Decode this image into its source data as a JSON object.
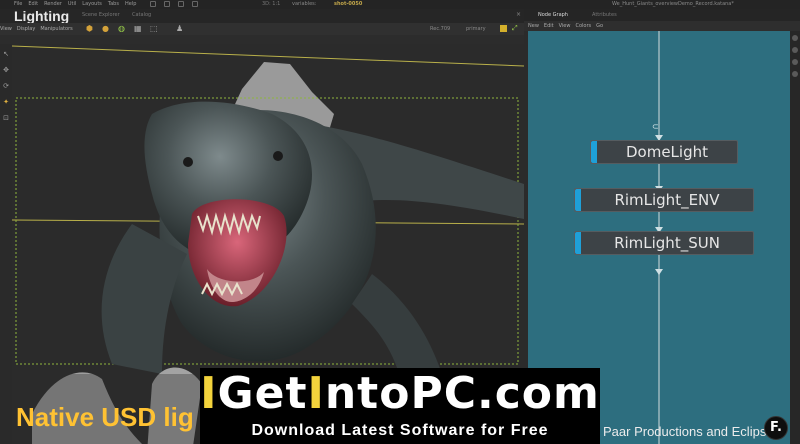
{
  "menubar": {
    "items": [
      "File",
      "Edit",
      "Render",
      "Util",
      "Layouts",
      "Tabs",
      "Help"
    ],
    "zoom_readout": "3D: 1:1",
    "variable_label": "variables:",
    "variable_value": "shot-0050",
    "project_title": "We_Hunt_Giants_overviewDemo_Record.katana*"
  },
  "viewer": {
    "title": "Lighting",
    "tabs": [
      "Scene Explorer",
      "Catalog"
    ],
    "menu": [
      "View",
      "Display",
      "Manipulators"
    ],
    "camera": "Rec.709",
    "layer": "primary",
    "close_glyph": "×"
  },
  "node_graph": {
    "tabs": [
      "Node Graph",
      "Attributes"
    ],
    "menu": [
      "New",
      "Edit",
      "View",
      "Colors",
      "Go"
    ],
    "nodes": [
      {
        "label": "DomeLight"
      },
      {
        "label": "RimLight_ENV"
      },
      {
        "label": "RimLight_SUN"
      }
    ],
    "accent_color": "#1fa0d8",
    "background_color": "#2d6e7f"
  },
  "overlay": {
    "logo_parts": [
      {
        "text": "I",
        "color": "#f3d33c"
      },
      {
        "text": "Get",
        "color": "#ffffff"
      },
      {
        "text": "I",
        "color": "#f3d33c"
      },
      {
        "text": "nto",
        "color": "#ffffff"
      },
      {
        "text": "PC",
        "color": "#ffffff"
      },
      {
        "text": ".com",
        "color": "#ffffff"
      }
    ],
    "tagline": "Download Latest Software for Free",
    "caption_left": "Native USD lig",
    "credit": "Paar Productions and Eclipse",
    "badge": "F."
  }
}
